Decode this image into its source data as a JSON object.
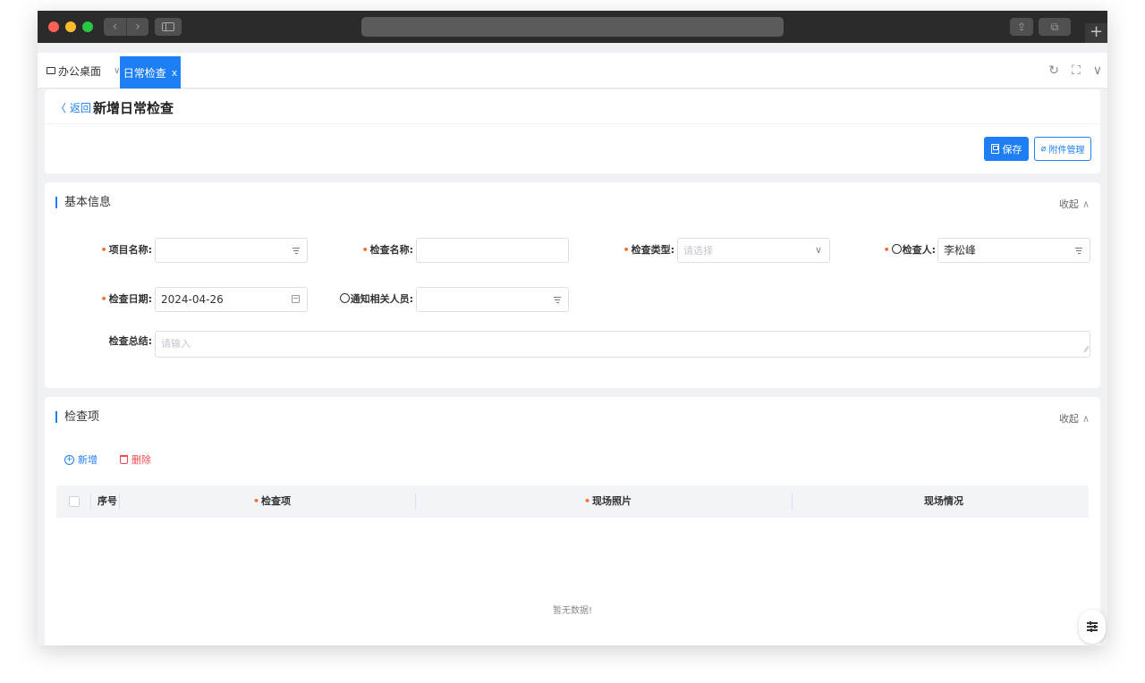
{
  "tabs": {
    "home_label": "办公桌面",
    "active_label": "日常检查",
    "active_close": "x",
    "refresh_glyph": "↻",
    "fullscreen_glyph": "⛶",
    "more_glyph": "∨"
  },
  "titlebar": {
    "back_glyph": "‹",
    "forward_glyph": "›",
    "share_glyph": "⇪",
    "tabs_glyph": "⧉",
    "new_tab_glyph": "+"
  },
  "header": {
    "back_label": "〈 返回",
    "title": "新增日常检查",
    "save_label": "保存",
    "attach_label": "附件管理",
    "attach_glyph": "⌀"
  },
  "basic": {
    "title": "基本信息",
    "collapse_label": "收起",
    "collapse_caret": "∧",
    "fields": {
      "project_label": "项目名称:",
      "inspection_name_label": "检查名称:",
      "inspection_type_label": "检查类型:",
      "inspection_type_placeholder": "请选择",
      "inspection_type_caret": "∨",
      "inspector_label": "检查人:",
      "inspector_value": "李松峰",
      "date_label": "检查日期:",
      "date_value": "2024-04-26",
      "notify_label": "通知相关人员:",
      "summary_label": "检查总结:",
      "summary_placeholder": "请输入",
      "required_mark": "•"
    }
  },
  "items": {
    "title": "检查项",
    "collapse_label": "收起",
    "collapse_caret": "∧",
    "add_label": "新增",
    "delete_label": "删除",
    "columns": [
      "序号",
      "检查项",
      "现场照片",
      "现场情况"
    ],
    "empty_text": "暂无数据!"
  },
  "colors": {
    "accent": "#1e7ff5",
    "danger": "#f5494b",
    "required": "#f56c2b"
  }
}
